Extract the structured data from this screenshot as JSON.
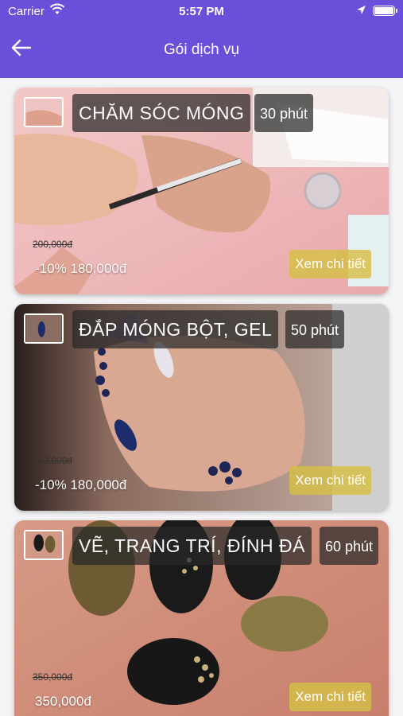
{
  "status_bar": {
    "carrier": "Carrier",
    "time": "5:57 PM"
  },
  "nav": {
    "title": "Gói dịch vụ",
    "back_icon": "arrow-left-icon"
  },
  "colors": {
    "header": "#6b4fdb",
    "detail_button": "#d6be46",
    "label_bg": "#282828"
  },
  "services": [
    {
      "name": "CHĂM SÓC MÓNG",
      "duration": "30 phút",
      "old_price": "200,000đ",
      "price": "-10% 180,000đ",
      "detail_label": "Xem chi tiết"
    },
    {
      "name": "ĐẮP MÓNG BỘT, GEL",
      "duration": "50 phút",
      "old_price": "200,000đ",
      "price": "-10% 180,000đ",
      "detail_label": "Xem chi tiết"
    },
    {
      "name": "VẼ, TRANG TRÍ, ĐÍNH ĐÁ",
      "duration": "60 phút",
      "old_price": "350,000đ",
      "price": "350,000đ",
      "detail_label": "Xem chi tiết"
    }
  ]
}
